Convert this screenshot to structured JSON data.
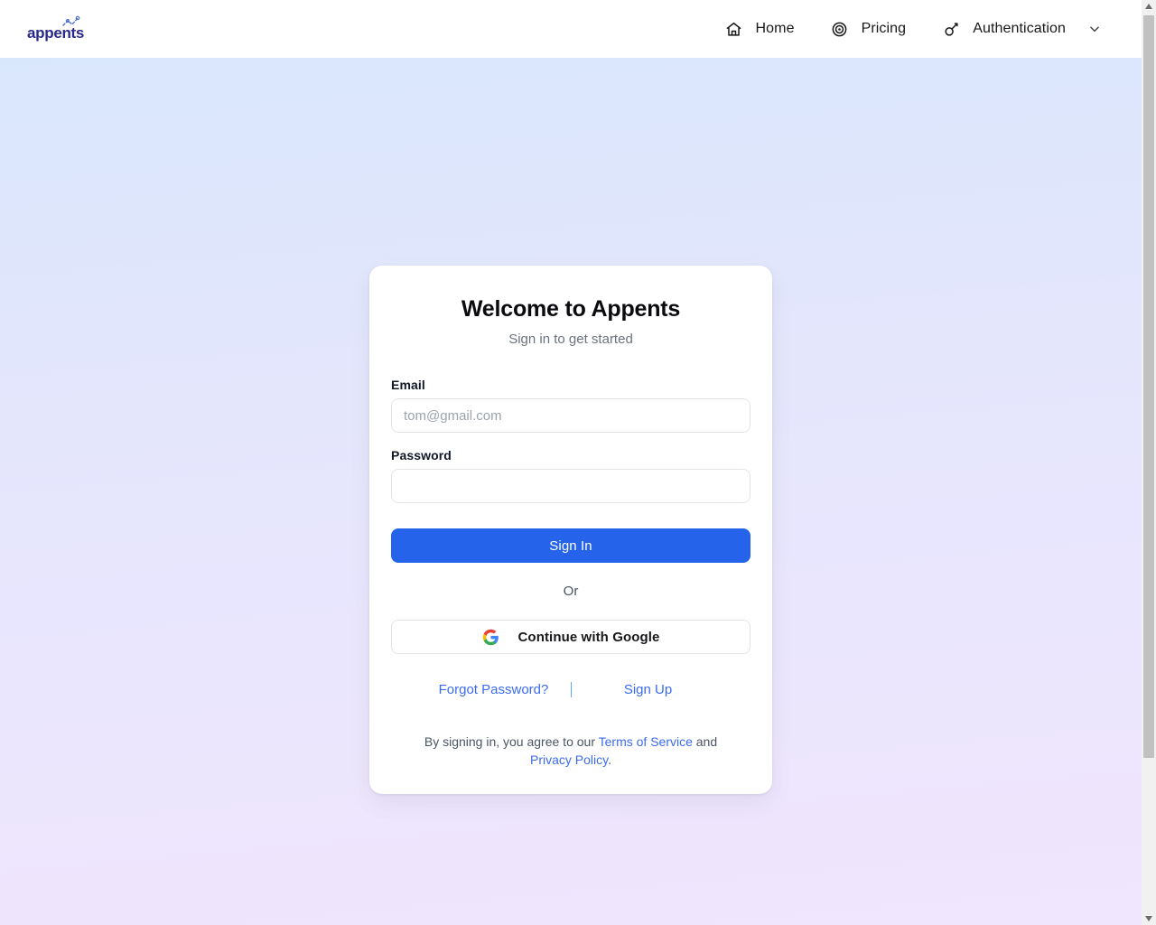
{
  "header": {
    "brand": {
      "name": "appents",
      "color": "#2a2a8c",
      "accent_color": "#4f6fd6"
    },
    "nav": [
      {
        "label": "Home",
        "icon": "home-icon",
        "has_chevron": false
      },
      {
        "label": "Pricing",
        "icon": "target-icon",
        "has_chevron": false
      },
      {
        "label": "Authentication",
        "icon": "key-icon",
        "has_chevron": true
      }
    ]
  },
  "background": {
    "gradient_top": "#d9e7fd",
    "gradient_bottom": "#f0e6fe"
  },
  "auth_card": {
    "title": "Welcome to Appents",
    "subtitle": "Sign in to get started",
    "fields": [
      {
        "label": "Email",
        "name": "email-field",
        "type": "email",
        "value": "",
        "placeholder": "tom@gmail.com"
      },
      {
        "label": "Password",
        "name": "password-field",
        "type": "password",
        "value": "",
        "placeholder": ""
      }
    ],
    "primary_button": {
      "label": "Sign In",
      "color": "#2563eb",
      "text_color": "#ffffff"
    },
    "separator_label": "Or",
    "google_button": {
      "label": "Continue with Google",
      "icon": "google-icon"
    },
    "links": {
      "forgot_password": "Forgot Password?",
      "sign_up": "Sign Up"
    },
    "legal": {
      "prefix": "By signing in, you agree to our ",
      "terms": "Terms of Service",
      "conjunction": " and ",
      "privacy": "Privacy Policy",
      "suffix": ".",
      "link_color": "#3b6cf0"
    }
  },
  "scrollbar": {
    "up_arrow": "▲",
    "down_arrow": "▼",
    "thumb_color": "#c1c1c1",
    "track_color": "#f1f1f1"
  }
}
